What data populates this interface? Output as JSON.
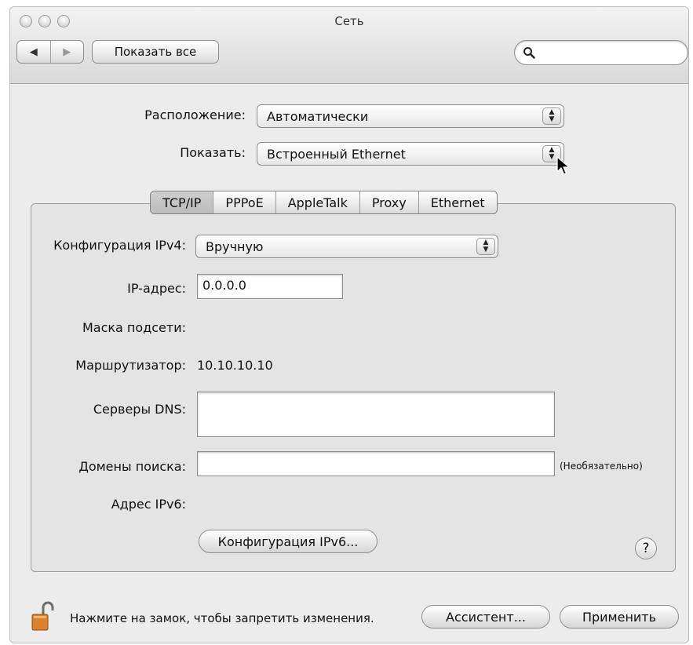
{
  "window": {
    "title": "Сеть"
  },
  "toolbar": {
    "back_glyph": "◀",
    "forward_glyph": "▶",
    "show_all_label": "Показать все",
    "search_placeholder": ""
  },
  "location": {
    "label": "Расположение:",
    "value": "Автоматически"
  },
  "show": {
    "label": "Показать:",
    "value": "Встроенный Ethernet"
  },
  "tabs": [
    {
      "label": "TCP/IP",
      "active": true
    },
    {
      "label": "PPPoE",
      "active": false
    },
    {
      "label": "AppleTalk",
      "active": false
    },
    {
      "label": "Proxy",
      "active": false
    },
    {
      "label": "Ethernet",
      "active": false
    }
  ],
  "tcpip": {
    "ipv4_config": {
      "label": "Конфигурация IPv4:",
      "value": "Вручную"
    },
    "ip_address": {
      "label": "IP-адрес:",
      "value": "0.0.0.0"
    },
    "subnet_mask": {
      "label": "Маска подсети:",
      "value": ""
    },
    "router": {
      "label": "Маршрутизатор:",
      "value": "10.10.10.10"
    },
    "dns_servers": {
      "label": "Серверы DNS:",
      "value": ""
    },
    "search_domains": {
      "label": "Домены поиска:",
      "value": "",
      "hint": "(Необязательно)"
    },
    "ipv6_address": {
      "label": "Адрес IPv6:",
      "value": ""
    },
    "ipv6_button": "Конфигурация IPv6..."
  },
  "help_glyph": "?",
  "footer": {
    "lock_text": "Нажмите на замок, чтобы запретить изменения.",
    "assistant_label": "Ассистент...",
    "apply_label": "Применить"
  },
  "colors": {
    "window_bg": "#ececec",
    "panel_bg": "#e4e4e4",
    "lock_orange": "#d9822b"
  }
}
